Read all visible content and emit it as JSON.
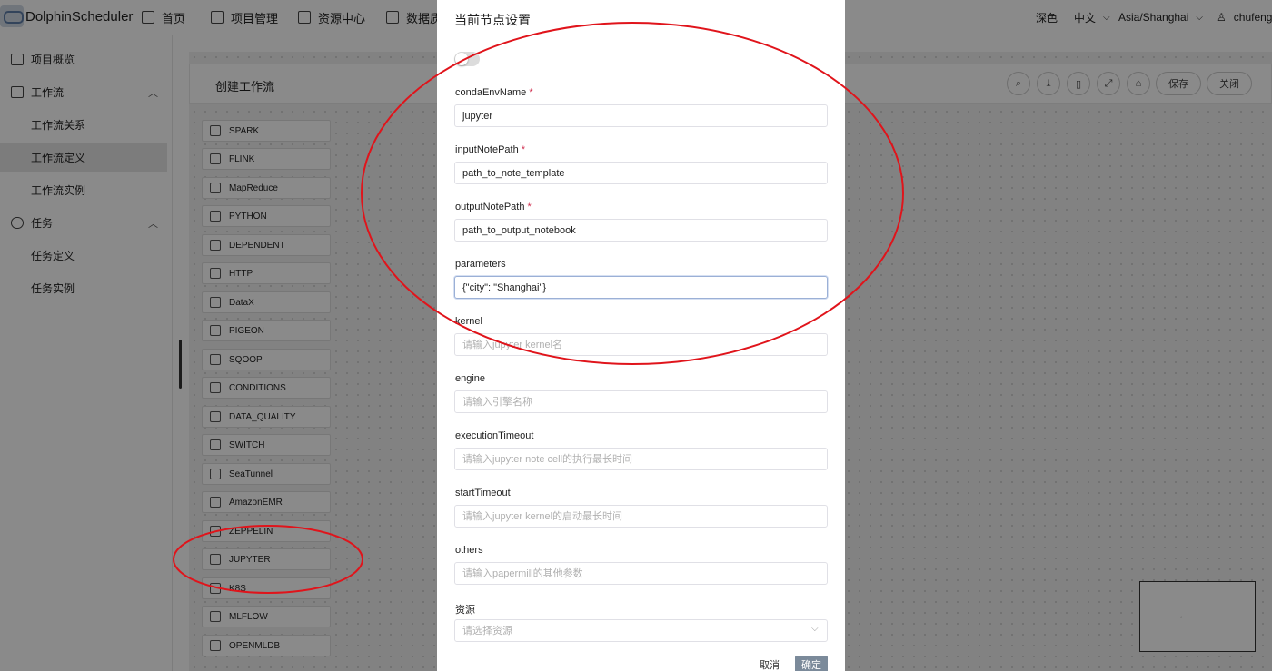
{
  "brand": {
    "name": "DolphinScheduler"
  },
  "topnav": {
    "items": [
      {
        "label": "首页",
        "icon": "home-icon"
      },
      {
        "label": "项目管理",
        "icon": "project-icon"
      },
      {
        "label": "资源中心",
        "icon": "folder-icon"
      },
      {
        "label": "数据质量",
        "icon": "data-quality-icon"
      }
    ],
    "theme": "深色",
    "language": "中文",
    "timezone": "Asia/Shanghai",
    "user": "chufeng"
  },
  "sidebar": {
    "items": [
      {
        "label": "项目概览"
      },
      {
        "label": "工作流"
      },
      {
        "label": "工作流关系"
      },
      {
        "label": "工作流定义"
      },
      {
        "label": "工作流实例"
      },
      {
        "label": "任务"
      },
      {
        "label": "任务定义"
      },
      {
        "label": "任务实例"
      }
    ]
  },
  "workflow": {
    "title": "创建工作流",
    "toolbar": {
      "save": "保存",
      "close": "关闭"
    }
  },
  "tasks": [
    "SPARK",
    "FLINK",
    "MapReduce",
    "PYTHON",
    "DEPENDENT",
    "HTTP",
    "DataX",
    "PIGEON",
    "SQOOP",
    "CONDITIONS",
    "DATA_QUALITY",
    "SWITCH",
    "SeaTunnel",
    "AmazonEMR",
    "ZEPPELIN",
    "JUPYTER",
    "K8S",
    "MLFLOW",
    "OPENMLDB"
  ],
  "drawer": {
    "title": "当前节点设置",
    "fields": {
      "condaEnvName": {
        "label": "condaEnvName",
        "required": "*",
        "value": "jupyter"
      },
      "inputNotePath": {
        "label": "inputNotePath",
        "required": "*",
        "value": "path_to_note_template"
      },
      "outputNotePath": {
        "label": "outputNotePath",
        "required": "*",
        "value": "path_to_output_notebook"
      },
      "parameters": {
        "label": "parameters",
        "value": "{\"city\": \"Shanghai\"}"
      },
      "kernel": {
        "label": "kernel",
        "placeholder": "请输入jupyter kernel名"
      },
      "engine": {
        "label": "engine",
        "placeholder": "请输入引擎名称"
      },
      "executionTimeout": {
        "label": "executionTimeout",
        "placeholder": "请输入jupyter note cell的执行最长时间"
      },
      "startTimeout": {
        "label": "startTimeout",
        "placeholder": "请输入jupyter kernel的启动最长时间"
      },
      "others": {
        "label": "others",
        "placeholder": "请输入papermill的其他参数"
      },
      "resource": {
        "label": "资源",
        "placeholder": "请选择资源"
      }
    },
    "buttons": {
      "cancel": "取消",
      "confirm": "确定"
    }
  }
}
